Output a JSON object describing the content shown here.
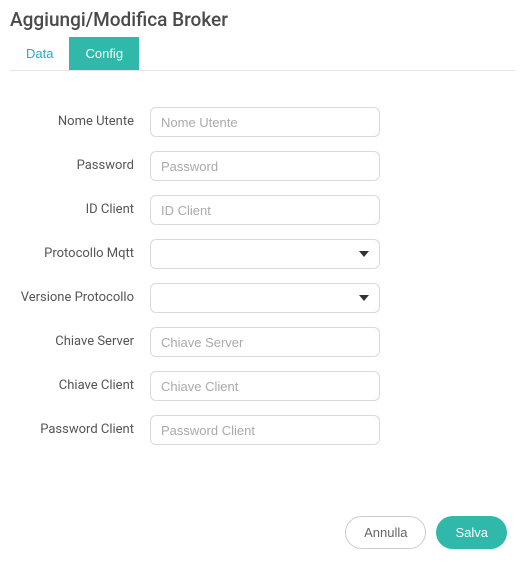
{
  "page": {
    "title": "Aggiungi/Modifica Broker"
  },
  "tabs": {
    "data": "Data",
    "config": "Config"
  },
  "form": {
    "nome_utente": {
      "label": "Nome Utente",
      "placeholder": "Nome Utente",
      "value": ""
    },
    "password": {
      "label": "Password",
      "placeholder": "Password",
      "value": ""
    },
    "id_client": {
      "label": "ID Client",
      "placeholder": "ID Client",
      "value": ""
    },
    "protocollo_mqtt": {
      "label": "Protocollo Mqtt",
      "value": ""
    },
    "versione_protocollo": {
      "label": "Versione Protocollo",
      "value": ""
    },
    "chiave_server": {
      "label": "Chiave Server",
      "placeholder": "Chiave Server",
      "value": ""
    },
    "chiave_client": {
      "label": "Chiave Client",
      "placeholder": "Chiave Client",
      "value": ""
    },
    "password_client": {
      "label": "Password Client",
      "placeholder": "Password Client",
      "value": ""
    }
  },
  "footer": {
    "cancel": "Annulla",
    "save": "Salva"
  }
}
